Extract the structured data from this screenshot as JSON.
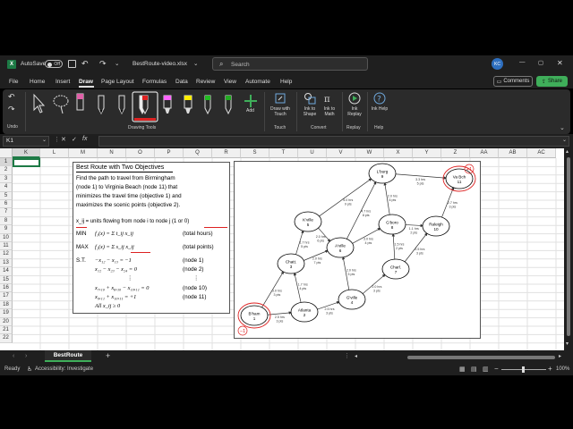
{
  "titlebar": {
    "autosave_label": "AutoSave",
    "autosave_state": "Off",
    "filename": "BestRoute-video.xlsx",
    "search_placeholder": "Search",
    "avatar_initials": "KC"
  },
  "menu": {
    "items": [
      "File",
      "Home",
      "Insert",
      "Draw",
      "Page Layout",
      "Formulas",
      "Data",
      "Review",
      "View",
      "Automate",
      "Help"
    ],
    "active": "Draw",
    "comments_label": "Comments",
    "share_label": "Share"
  },
  "ribbon": {
    "undo_label": "Undo",
    "drawing_tools_label": "Drawing Tools",
    "add_label": "Add",
    "touch_group": {
      "button": "Draw with Touch",
      "label": "Touch"
    },
    "convert_group": {
      "ink_to_shape": "Ink to Shape",
      "ink_to_math": "Ink to Math",
      "label": "Convert"
    },
    "replay_group": {
      "button": "Ink Replay",
      "label": "Replay"
    },
    "help_group": {
      "button": "Ink Help",
      "label": "Help"
    },
    "pen_colors": [
      "#000000",
      "#000000",
      "#ffffff",
      "#cc2222",
      "#ff66ff",
      "#ffee00",
      "#22bb22",
      "#22aa22"
    ]
  },
  "formula_bar": {
    "cell_ref": "K1",
    "fx": "fx",
    "value": ""
  },
  "grid": {
    "columns": [
      "K",
      "L",
      "M",
      "N",
      "O",
      "P",
      "Q",
      "R",
      "S",
      "T",
      "U",
      "V",
      "W",
      "X",
      "Y",
      "Z",
      "AA",
      "AB",
      "AC"
    ],
    "rows": [
      "1",
      "2",
      "3",
      "4",
      "5",
      "6",
      "7",
      "8",
      "9",
      "10",
      "11",
      "12",
      "13",
      "14",
      "15",
      "16",
      "17",
      "18",
      "19",
      "20",
      "21",
      "22"
    ]
  },
  "textbox": {
    "title": "Best Route with Two Objectives",
    "desc": [
      "Find the path to travel from Birmingham",
      "(node 1) to Virginia Beach (node 11) that",
      "minimizes the travel time (objective 1) and",
      "maximizes the scenic points (objective 2)."
    ],
    "units_line": "x_ij = units flowing from node i to node j (1 or 0)",
    "min_label": "MIN",
    "min_expr": "f₁(x) = Σ t_ij x_ij",
    "min_note": "(total hours)",
    "max_label": "MAX",
    "max_expr": "f₂(x) = Σ s_ij x_ij",
    "max_note": "(total points)",
    "st_label": "S.T.",
    "constraints": [
      {
        "expr": "−x₁₂ − x₁₃ = −1",
        "note": "(node 1)"
      },
      {
        "expr": "x₁₂ − x₂₃ − x₂₄ = 0",
        "note": "(node 2)"
      },
      {
        "expr": "⋮",
        "note": "⋮"
      },
      {
        "expr": "x₇,₁₀ + x₈,₁₀ − x₁₀,₁₁ = 0",
        "note": "(node 10)"
      },
      {
        "expr": "x₉,₁₁ + x₁₀,₁₁ = +1",
        "note": "(node 11)"
      },
      {
        "expr": "All x_ij ≥ 0",
        "note": ""
      }
    ]
  },
  "network": {
    "nodes": [
      {
        "id": "1",
        "name": "B'ham"
      },
      {
        "id": "2",
        "name": "Atlanta"
      },
      {
        "id": "3",
        "name": "Chatt."
      },
      {
        "id": "4",
        "name": "G'ville"
      },
      {
        "id": "5",
        "name": "K'ville"
      },
      {
        "id": "6",
        "name": "A'ville"
      },
      {
        "id": "7",
        "name": "Charl."
      },
      {
        "id": "8",
        "name": "G'boro"
      },
      {
        "id": "9",
        "name": "L'burg"
      },
      {
        "id": "10",
        "name": "Raleigh"
      },
      {
        "id": "11",
        "name": "Va Bch"
      }
    ],
    "edges": [
      {
        "from": "1",
        "to": "2",
        "hrs": "2.5 hrs",
        "pts": "3 pts"
      },
      {
        "from": "1",
        "to": "3",
        "hrs": "3.0 hrs",
        "pts": "3 pts"
      },
      {
        "from": "2",
        "to": "3",
        "hrs": "1.7 hrs",
        "pts": "4 pts"
      },
      {
        "from": "2",
        "to": "4",
        "hrs": "2.5 hrs",
        "pts": "3 pts"
      },
      {
        "from": "3",
        "to": "5",
        "hrs": "1.7 hrs",
        "pts": "5 pts"
      },
      {
        "from": "3",
        "to": "6",
        "hrs": "2.0 hrs",
        "pts": "7 pts"
      },
      {
        "from": "4",
        "to": "6",
        "hrs": "2.0 hrs",
        "pts": "5 pts"
      },
      {
        "from": "4",
        "to": "7",
        "hrs": "2.0 hrs",
        "pts": "3 pts"
      },
      {
        "from": "5",
        "to": "6",
        "hrs": "2.0 hrs",
        "pts": "6 pts"
      },
      {
        "from": "5",
        "to": "9",
        "hrs": "5.0 hrs",
        "pts": "9 pts"
      },
      {
        "from": "6",
        "to": "8",
        "hrs": "3.0 hrs",
        "pts": "4 pts"
      },
      {
        "from": "6",
        "to": "9",
        "hrs": "4.7 hrs",
        "pts": "8 pts"
      },
      {
        "from": "7",
        "to": "8",
        "hrs": "1.5 hrs",
        "pts": "2 pts"
      },
      {
        "from": "7",
        "to": "10",
        "hrs": "2.5 hrs",
        "pts": "3 pts"
      },
      {
        "from": "8",
        "to": "9",
        "hrs": "2.0 hrs",
        "pts": "6 pts"
      },
      {
        "from": "8",
        "to": "10",
        "hrs": "1.1 hrs",
        "pts": "2 pts"
      },
      {
        "from": "9",
        "to": "11",
        "hrs": "3.3 hrs",
        "pts": "5 pts"
      },
      {
        "from": "10",
        "to": "11",
        "hrs": "2.7 hrs",
        "pts": "3 pts"
      }
    ],
    "ink_marks": [
      {
        "near": "1",
        "text": "−1"
      },
      {
        "near": "11",
        "text": "+1"
      }
    ]
  },
  "sheet": {
    "tab": "BestRoute",
    "add": "+"
  },
  "status": {
    "ready": "Ready",
    "accessibility": "Accessibility: Investigate",
    "zoom": "100%"
  }
}
